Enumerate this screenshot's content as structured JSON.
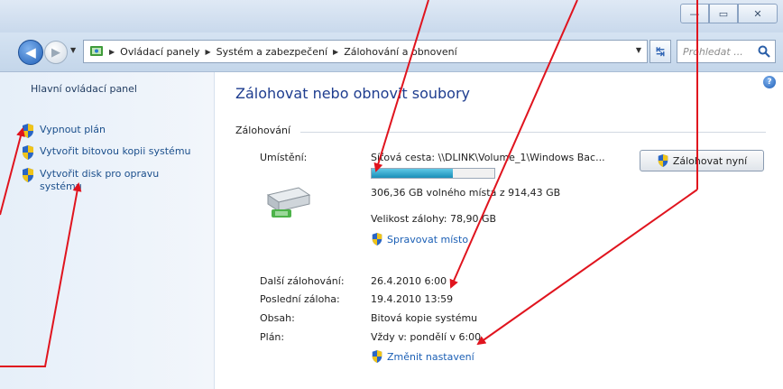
{
  "window": {
    "minimize_glyph": "—",
    "maximize_glyph": "▭",
    "close_glyph": "✕"
  },
  "nav": {
    "breadcrumbs": [
      "Ovládací panely",
      "Systém a zabezpečení",
      "Zálohování a obnovení"
    ],
    "search_placeholder": "Prohledat ..."
  },
  "sidebar": {
    "home_label": "Hlavní ovládací panel",
    "items": [
      {
        "label": "Vypnout plán",
        "icon": "shield-icon"
      },
      {
        "label": "Vytvořit bitovou kopii systému",
        "icon": "shield-icon"
      },
      {
        "label": "Vytvořit disk pro opravu systému",
        "icon": "shield-icon"
      }
    ]
  },
  "main": {
    "title": "Zálohovat nebo obnovit soubory",
    "section_title": "Zálohování",
    "location_label": "Umístění:",
    "location_value": "Síťová cesta: \\\\DLINK\\Volume_1\\Windows Bac...",
    "disk_used_fraction": 0.665,
    "free_space": "306,36 GB volného místa z 914,43 GB",
    "backup_size": "Velikost zálohy: 78,90 GB",
    "manage_space_link": "Spravovat místo",
    "backup_now_button": "Zálohovat nyní",
    "next_backup_label": "Další zálohování:",
    "next_backup_value": "26.4.2010 6:00",
    "last_backup_label": "Poslední záloha:",
    "last_backup_value": "19.4.2010 13:59",
    "contents_label": "Obsah:",
    "contents_value": "Bitová kopie systému",
    "schedule_label": "Plán:",
    "schedule_value": "Vždy v: pondělí v 6:00",
    "change_settings_link": "Změnit nastavení"
  },
  "colors": {
    "link": "#1b5fb5",
    "title": "#1e3d8f",
    "annotation_arrow": "#e0141e"
  }
}
